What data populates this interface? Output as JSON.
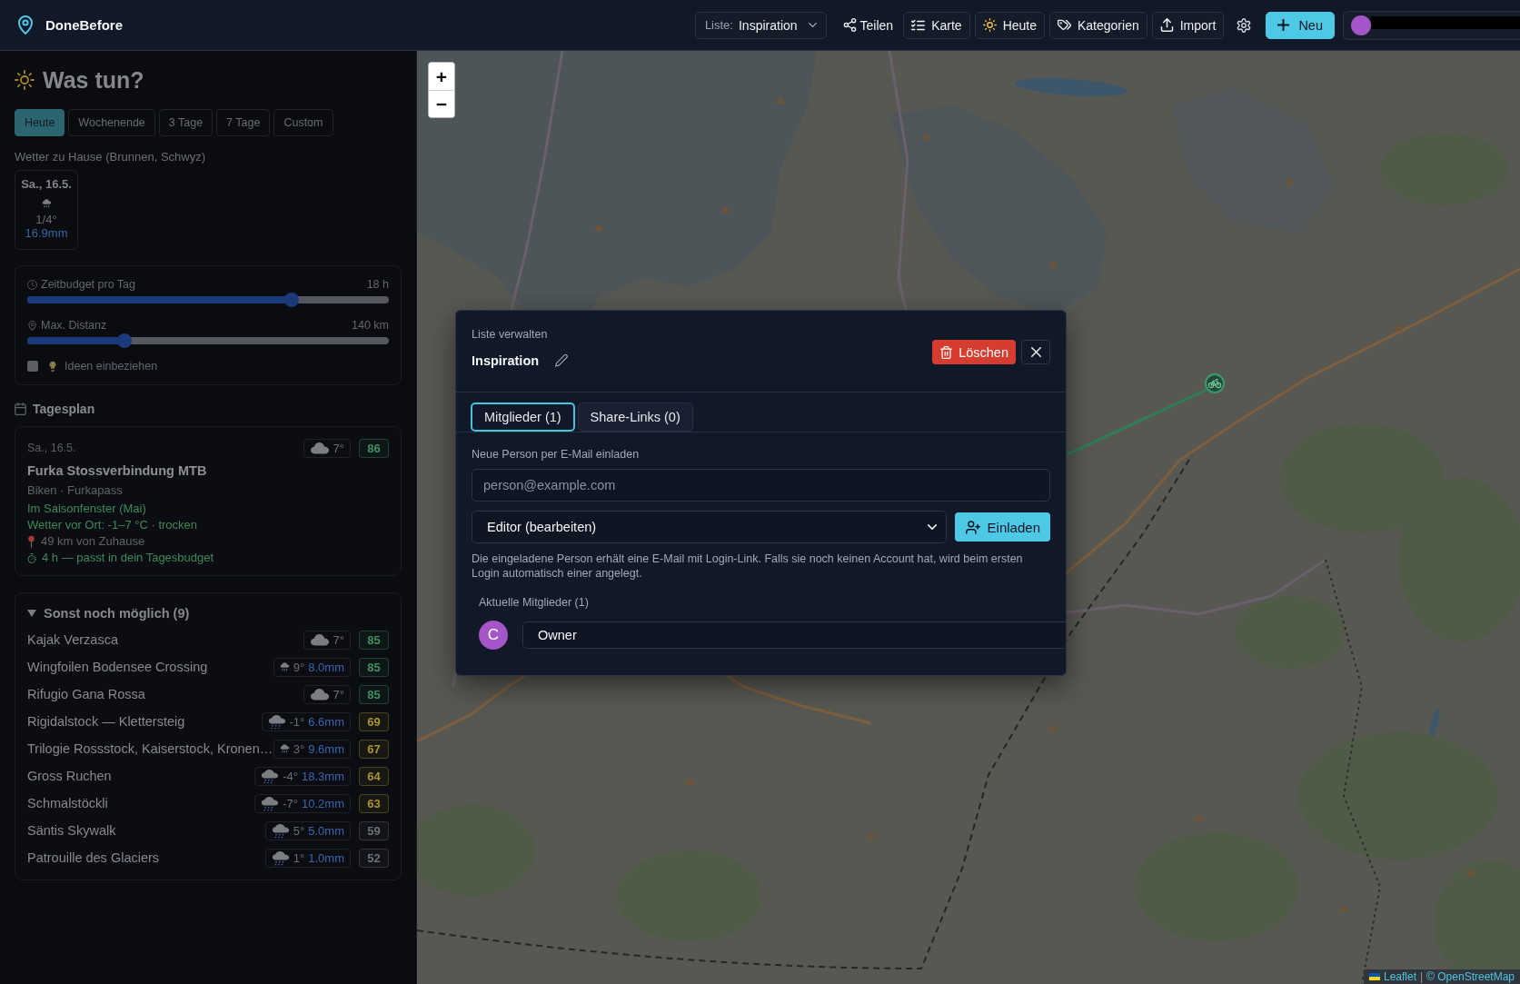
{
  "header": {
    "app_name": "DoneBefore",
    "list_select": {
      "label": "Liste:",
      "value": "Inspiration"
    },
    "share_button": "Teilen",
    "map_button": "Karte",
    "today_button": "Heute",
    "categories_button": "Kategorien",
    "import_button": "Import",
    "new_button": "Neu"
  },
  "planner": {
    "title": "Was tun?",
    "ranges": [
      {
        "label": "Heute",
        "selected": true
      },
      {
        "label": "Wochenende",
        "selected": false
      },
      {
        "label": "3 Tage",
        "selected": false
      },
      {
        "label": "7 Tage",
        "selected": false
      },
      {
        "label": "Custom",
        "selected": false
      }
    ],
    "home_weather": {
      "label": "Wetter zu Hause (Brunnen, Schwyz)",
      "days": [
        {
          "date": "Sa., 16.5.",
          "weather": {
            "kind": "showers",
            "temp": "1/4°",
            "precip": "16.9mm"
          }
        }
      ]
    },
    "filters": {
      "time_budget": {
        "label": "Zeitbudget pro Tag",
        "reading": "18 h",
        "level": 0.73
      },
      "max_distance": {
        "label": "Max. Distanz",
        "reading": "140 km",
        "level": 0.27
      },
      "ideas": {
        "label": "Ideen einbeziehen",
        "checked": false
      }
    },
    "day_plan": {
      "title": "Tagesplan",
      "date": "Sa., 16.5.",
      "weather": {
        "kind": "cloudy",
        "temp": "7°"
      },
      "score": "86",
      "color": "#3f9163",
      "name": "Furka Stossverbindung MTB",
      "subtitle": "Biken · Furkapass",
      "notes": [
        {
          "kind": "positive",
          "text": "Im Saisonfenster (Mai)"
        },
        {
          "kind": "positive",
          "text": "Wetter vor Ort: -1–7 °C · trocken"
        },
        {
          "kind": "distance",
          "text": "49 km von Zuhause"
        },
        {
          "kind": "time",
          "text": "4 h — passt in dein Tagesbudget"
        }
      ]
    },
    "alternatives": {
      "title": "Sonst noch möglich (9)",
      "expanded": true,
      "items": [
        {
          "name": "Kajak Verzasca",
          "weather": {
            "kind": "cloudy",
            "temp": "7°"
          },
          "score": "85",
          "color": "#3f9163"
        },
        {
          "name": "Wingfoilen Bodensee Crossing",
          "weather": {
            "kind": "showers",
            "temp": "9°",
            "precip": "8.0mm"
          },
          "score": "85",
          "color": "#3f9163"
        },
        {
          "name": "Rifugio Gana Rossa",
          "weather": {
            "kind": "cloudy",
            "temp": "7°"
          },
          "score": "85",
          "color": "#3f9163"
        },
        {
          "name": "Rigidalstock — Klettersteig",
          "weather": {
            "kind": "rain",
            "temp": "-1°",
            "precip": "6.6mm"
          },
          "score": "69",
          "color": "#a8952e"
        },
        {
          "name": "Trilogie Rossstock, Kaiserstock, Kronen…",
          "weather": {
            "kind": "showers",
            "temp": "3°",
            "precip": "9.6mm"
          },
          "score": "67",
          "color": "#a8952e"
        },
        {
          "name": "Gross Ruchen",
          "weather": {
            "kind": "rain",
            "temp": "-4°",
            "precip": "18.3mm"
          },
          "score": "64",
          "color": "#a8952e"
        },
        {
          "name": "Schmalstöckli",
          "weather": {
            "kind": "rain",
            "temp": "-7°",
            "precip": "10.2mm"
          },
          "score": "63",
          "color": "#a8952e"
        },
        {
          "name": "Säntis Skywalk",
          "weather": {
            "kind": "rain",
            "temp": "5°",
            "precip": "5.0mm"
          },
          "score": "59",
          "color": "#6b7078"
        },
        {
          "name": "Patrouille des Glaciers",
          "weather": {
            "kind": "rain",
            "temp": "1°",
            "precip": "1.0mm"
          },
          "score": "52",
          "color": "#6b7078"
        }
      ]
    }
  },
  "map": {
    "zoom_in": "+",
    "zoom_out": "−",
    "attribution": {
      "leaflet": "Leaflet",
      "separator": "|",
      "osm": "© OpenStreetMap"
    }
  },
  "modal": {
    "eyebrow": "Liste verwalten",
    "list_name": "Inspiration",
    "delete_button": "Löschen",
    "tabs": [
      {
        "label": "Mitglieder (1)",
        "selected": true
      },
      {
        "label": "Share-Links (0)",
        "selected": false
      }
    ],
    "invite": {
      "label": "Neue Person per E-Mail einladen",
      "email": {
        "placeholder": "person@example.com"
      },
      "role": {
        "value": "Editor (bearbeiten)"
      },
      "button": "Einladen",
      "hint": "Die eingeladene Person erhält eine E-Mail mit Login-Link. Falls sie noch keinen Account hat, wird beim ersten Login automatisch einer angelegt."
    },
    "members": {
      "title": "Aktuelle Mitglieder (1)",
      "items": [
        {
          "initial": "C",
          "role": "Owner"
        }
      ]
    }
  }
}
